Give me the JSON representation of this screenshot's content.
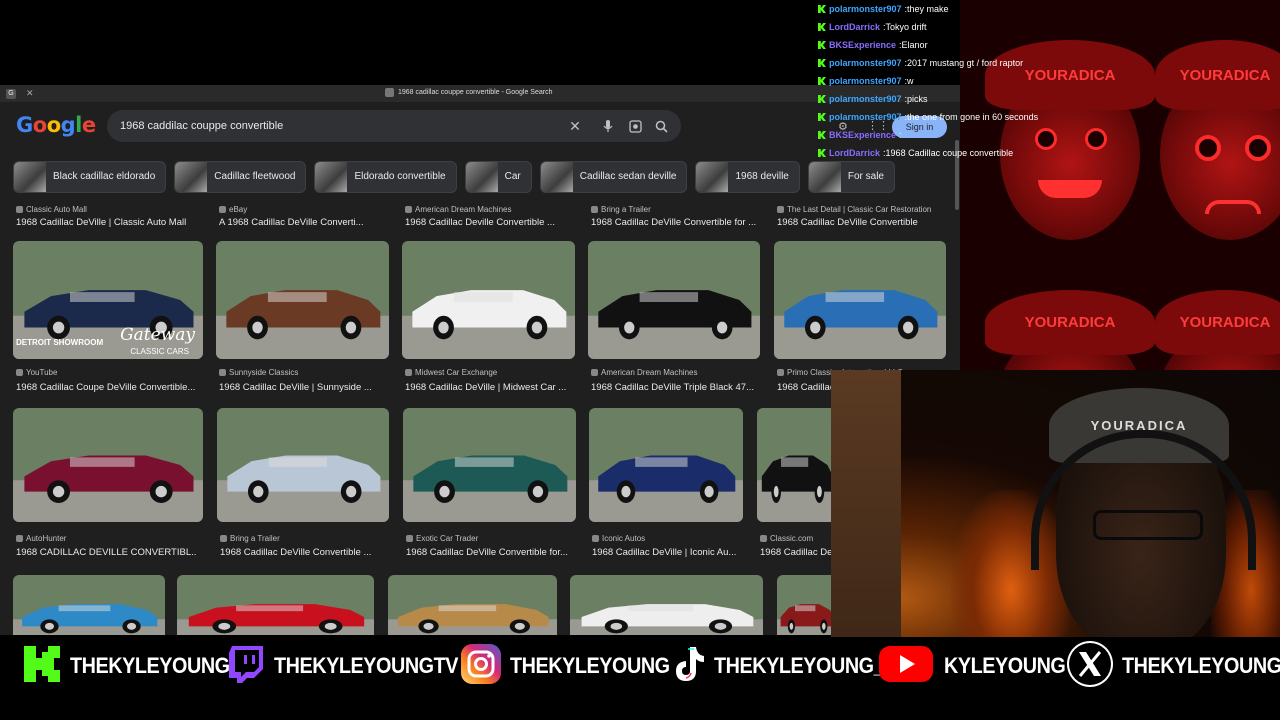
{
  "chat": [
    {
      "user": "polarmonster907",
      "color": "#3ea6ff",
      "message": "they make"
    },
    {
      "user": "LordDarrick",
      "color": "#8a6cff",
      "message": "Tokyo drift"
    },
    {
      "user": "BKSExperience",
      "color": "#8a6cff",
      "message": "Elanor"
    },
    {
      "user": "polarmonster907",
      "color": "#3ea6ff",
      "message": "2017 mustang gt / ford raptor"
    },
    {
      "user": "polarmonster907",
      "color": "#3ea6ff",
      "message": "w"
    },
    {
      "user": "polarmonster907",
      "color": "#3ea6ff",
      "message": "picks"
    },
    {
      "user": "polarmonster907",
      "color": "#3ea6ff",
      "message": "the one from gone in 60 seconds"
    },
    {
      "user": "BKSExperience",
      "color": "#8a6cff",
      "message": ""
    },
    {
      "user": "LordDarrick",
      "color": "#8a6cff",
      "message": "1968 Cadillac coupe convertible"
    }
  ],
  "browser": {
    "tab_title": "1968 cadillac couppe convertible - Google Search",
    "logo": "Google",
    "query": "1968 caddilac couppe convertible",
    "sign_in": "Sign in"
  },
  "chips": [
    "Black cadillac eldorado",
    "Cadillac fleetwood",
    "Eldorado convertible",
    "Car",
    "Cadillac sedan deville",
    "1968 deville",
    "For sale"
  ],
  "results_row0": [
    {
      "source": "Classic Auto Mall",
      "title": "1968 Cadillac DeVille | Classic Auto Mall"
    },
    {
      "source": "eBay",
      "title": "A 1968 Cadillac DeVille Converti..."
    },
    {
      "source": "American Dream Machines",
      "title": "1968 Cadillac Deville Convertible ..."
    },
    {
      "source": "Bring a Trailer",
      "title": "1968 Cadillac DeVille Convertible for ..."
    },
    {
      "source": "The Last Detail | Classic Car Restoration",
      "title": "1968 Cadillac DeVille Convertible"
    }
  ],
  "results_row1": [
    {
      "source": "YouTube",
      "title": "1968 Cadillac Coupe DeVille Convertible...",
      "overlay1": "DETROIT SHOWROOM",
      "overlay2": "Gateway",
      "overlay3": "CLASSIC CARS",
      "color": "#1b2a4a"
    },
    {
      "source": "Sunnyside Classics",
      "title": "1968 Cadillac DeVille | Sunnyside ...",
      "color": "#6a3a24"
    },
    {
      "source": "Midwest Car Exchange",
      "title": "1968 Cadillac DeVille | Midwest Car ...",
      "color": "#f0f0f0"
    },
    {
      "source": "American Dream Machines",
      "title": "1968 Cadillac DeVille Triple Black 47...",
      "color": "#111111"
    },
    {
      "source": "Primo Classics International LLC",
      "title": "1968 Cadillac",
      "color": "#2a6fb5"
    }
  ],
  "results_row2": [
    {
      "source": "AutoHunter",
      "title": "1968 CADILLAC DEVILLE CONVERTIBL...",
      "color": "#7a1030"
    },
    {
      "source": "Bring a Trailer",
      "title": "1968 Cadillac DeVille Convertible ...",
      "color": "#b9c6d6"
    },
    {
      "source": "Exotic Car Trader",
      "title": "1968 Cadillac DeVille Convertible for...",
      "color": "#1d5a55"
    },
    {
      "source": "Iconic Autos",
      "title": "1968 Cadillac DeVille | Iconic Au...",
      "color": "#1a2d6a"
    },
    {
      "source": "Classic.com",
      "title": "1968 Cadillac De",
      "color": "#111111"
    }
  ],
  "results_row3": [
    {
      "color": "#2d8ac7"
    },
    {
      "color": "#c8101e"
    },
    {
      "color": "#b88a4a"
    },
    {
      "color": "#eeeeee"
    },
    {
      "color": "#8a1a1a"
    }
  ],
  "art_text": [
    "YOURADICA",
    "YOURADICA",
    "YOURADICA",
    "YOURADICA"
  ],
  "cam_hat": "YOURADICA",
  "social": [
    {
      "icon": "kick-icon",
      "label": "THEKYLEYOUNG"
    },
    {
      "icon": "twitch-icon",
      "label": "THEKYLEYOUNGTV"
    },
    {
      "icon": "instagram-icon",
      "label": "THEKYLEYOUNG"
    },
    {
      "icon": "tiktok-icon",
      "label": "THEKYLEYOUNG_"
    },
    {
      "icon": "youtube-icon",
      "label": "KYLEYOUNG"
    },
    {
      "icon": "x-icon",
      "label": "THEKYLEYOUNG"
    }
  ]
}
